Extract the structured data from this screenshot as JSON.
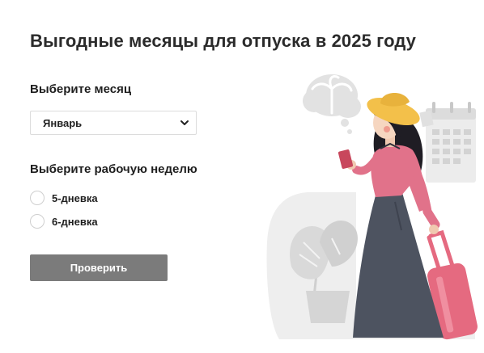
{
  "page": {
    "title": "Выгодные месяцы для отпуска в 2025 году"
  },
  "month_selector": {
    "label": "Выберите месяц",
    "selected": "Январь"
  },
  "workweek": {
    "label": "Выберите рабочую неделю",
    "options": [
      {
        "label": "5-дневка",
        "checked": false
      },
      {
        "label": "6-дневка",
        "checked": false
      }
    ]
  },
  "actions": {
    "check_label": "Проверить"
  },
  "colors": {
    "button_bg": "#7b7b7b",
    "hat": "#f3c04a",
    "shirt": "#e1728a",
    "skirt": "#4d5360",
    "suitcase": "#e56a80",
    "illustration_grey": "#e6e6e6"
  }
}
